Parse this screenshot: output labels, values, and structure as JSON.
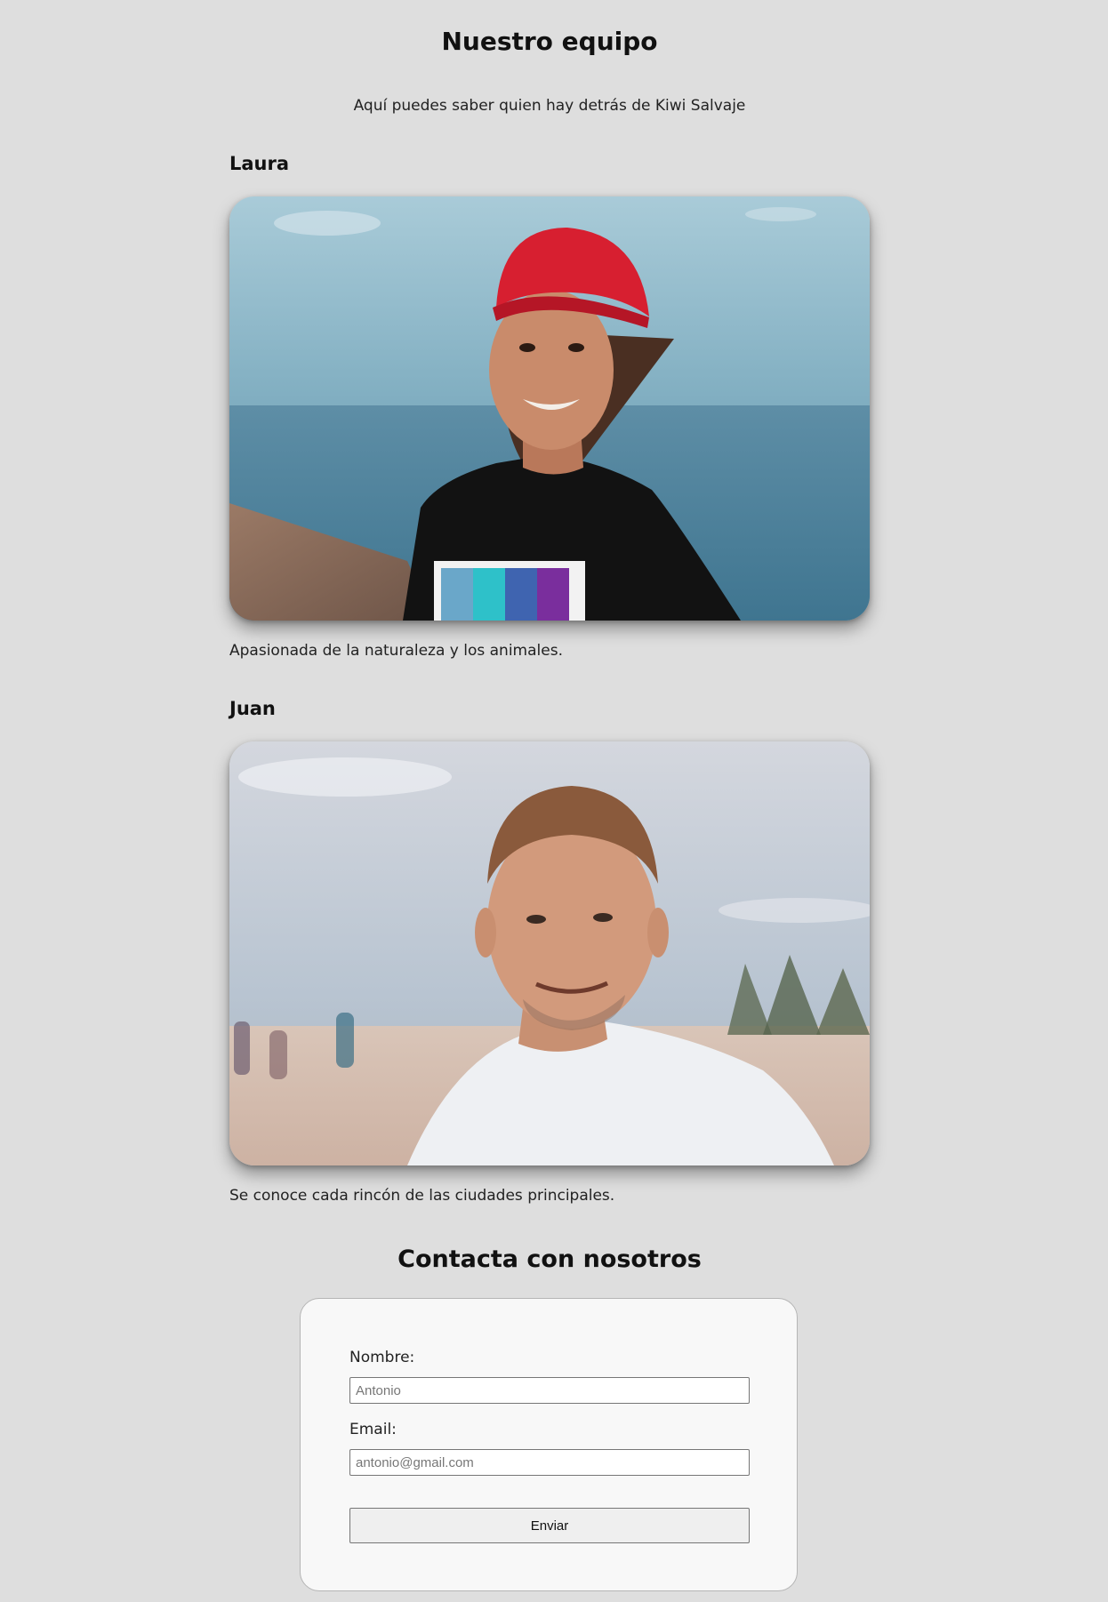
{
  "header": {
    "title": "Nuestro equipo",
    "subtitle": "Aquí puedes saber quien hay detrás de Kiwi Salvaje"
  },
  "team": [
    {
      "name": "Laura",
      "photo_alt": "Laura",
      "description": "Apasionada de la naturaleza y los animales."
    },
    {
      "name": "Juan",
      "photo_alt": "Juan",
      "description": "Se conoce cada rincón de las ciudades principales."
    }
  ],
  "contact": {
    "title": "Contacta con nosotros",
    "name_label": "Nombre:",
    "name_placeholder": "Antonio",
    "email_label": "Email:",
    "email_placeholder": "antonio@gmail.com",
    "submit_label": "Enviar"
  }
}
